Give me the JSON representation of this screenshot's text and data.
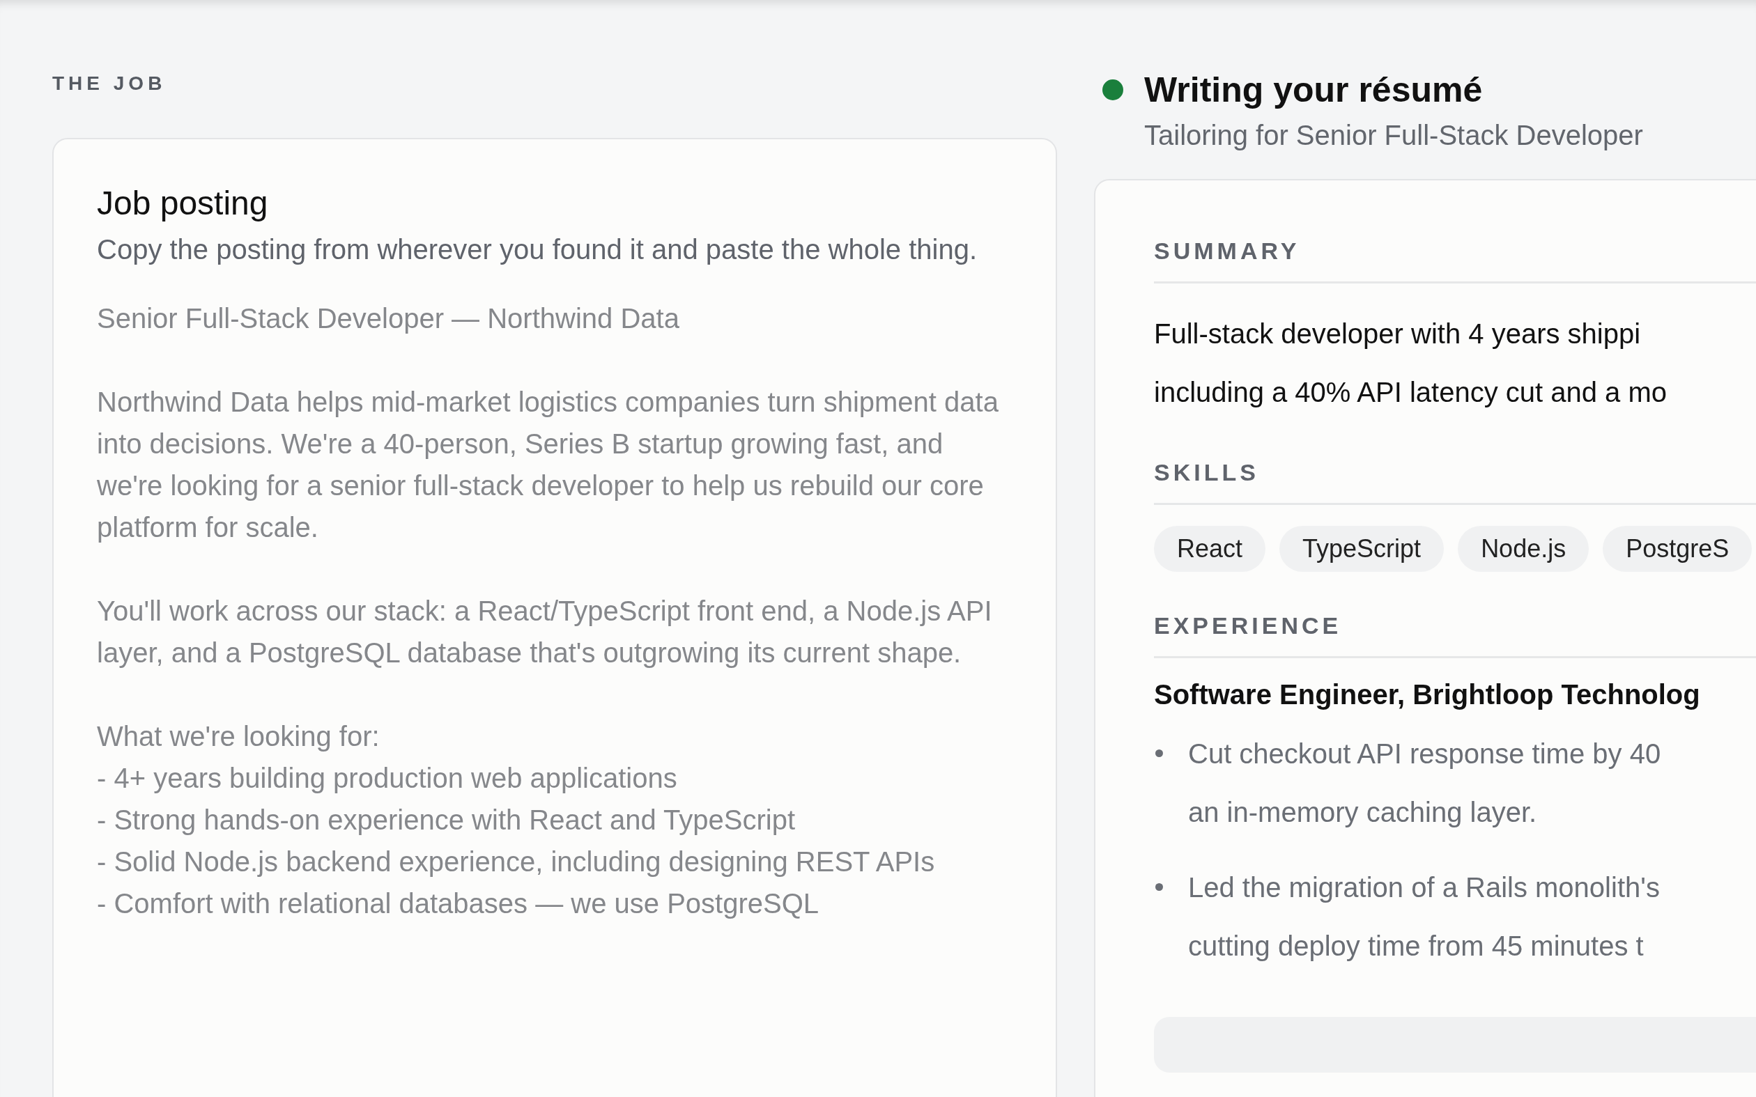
{
  "job": {
    "section_label": "THE JOB",
    "title": "Job posting",
    "hint": "Copy the posting from wherever you found it and paste the whole thing.",
    "posting": "Senior Full-Stack Developer — Northwind Data\n\nNorthwind Data helps mid-market logistics companies turn shipment data into decisions. We're a 40-person, Series B startup growing fast, and we're looking for a senior full-stack developer to help us rebuild our core platform for scale.\n\nYou'll work across our stack: a React/TypeScript front end, a Node.js API layer, and a PostgreSQL database that's outgrowing its current shape.\n\nWhat we're looking for:\n- 4+ years building production web applications\n- Strong hands-on experience with React and TypeScript\n- Solid Node.js backend experience, including designing REST APIs\n- Comfort with relational databases — we use PostgreSQL"
  },
  "resume": {
    "active": true,
    "title": "Writing your résumé",
    "subtitle": "Tailoring for Senior Full-Stack Developer",
    "summary": {
      "label": "SUMMARY",
      "lines": [
        "Full-stack developer with 4 years shippi",
        "including a 40% API latency cut and a mo"
      ]
    },
    "skills": {
      "label": "SKILLS",
      "items": [
        "React",
        "TypeScript",
        "Node.js",
        "PostgreS"
      ]
    },
    "experience": {
      "label": "EXPERIENCE",
      "role": "Software Engineer, Brightloop Technolog",
      "bullets": [
        {
          "lines": [
            "Cut checkout API response time by 40",
            "an in-memory caching layer."
          ]
        },
        {
          "lines": [
            "Led the migration of a Rails monolith's",
            "cutting deploy time from 45 minutes t"
          ]
        }
      ]
    }
  }
}
